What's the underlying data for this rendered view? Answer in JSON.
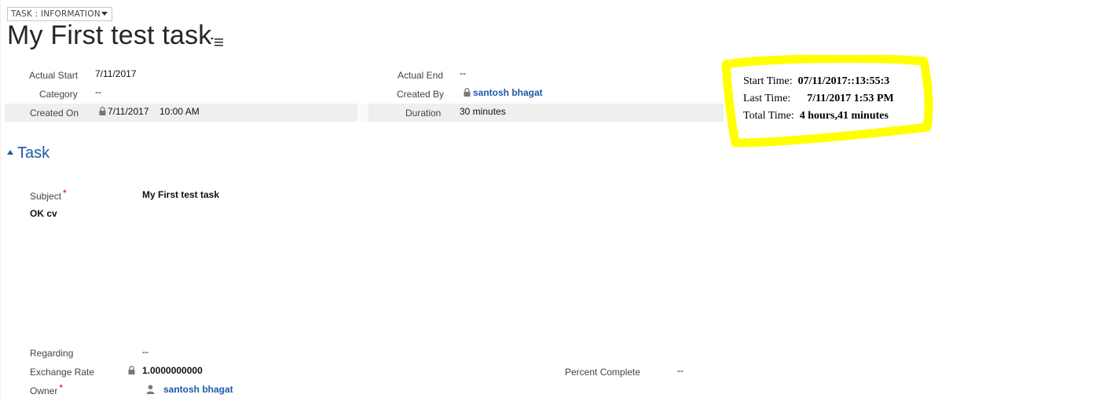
{
  "form_selector": {
    "label": "TASK : INFORMATION"
  },
  "title": "My First test task",
  "header": {
    "actual_start": {
      "label": "Actual Start",
      "value": "7/11/2017"
    },
    "category": {
      "label": "Category",
      "value": "--"
    },
    "created_on": {
      "label": "Created On",
      "date": "7/11/2017",
      "time": "10:00 AM"
    },
    "actual_end": {
      "label": "Actual End",
      "value": "--"
    },
    "created_by": {
      "label": "Created By",
      "value": "santosh bhagat"
    },
    "duration": {
      "label": "Duration",
      "value": "30 minutes"
    }
  },
  "annotation": {
    "start_label": "Start Time:",
    "start_value": "07/11/2017::13:55:3",
    "last_label": "Last Time:",
    "last_value": "7/11/2017 1:53 PM",
    "total_label": "Total Time:",
    "total_value": "4 hours,41 minutes",
    "highlight_color": "#ffff00"
  },
  "section": {
    "title": "Task",
    "subject": {
      "label": "Subject",
      "value": "My First test task"
    },
    "description": "OK cv",
    "regarding": {
      "label": "Regarding",
      "value": "--"
    },
    "exchange_rate": {
      "label": "Exchange Rate",
      "value": "1.0000000000"
    },
    "owner": {
      "label": "Owner",
      "value": "santosh bhagat"
    },
    "percent_complete": {
      "label": "Percent Complete",
      "value": "--"
    }
  },
  "colors": {
    "link": "#1d5aa8",
    "required": "#cc0000",
    "row_highlight": "#efefef"
  }
}
